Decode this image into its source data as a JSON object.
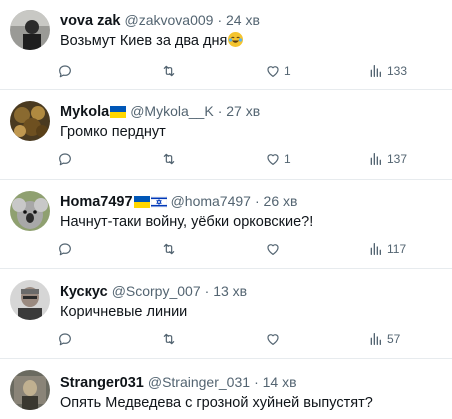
{
  "tweets": [
    {
      "name": "vova zak",
      "handle": "@zakvova009",
      "time": "· 24 хв",
      "text": "Возьмут Киев за два дня",
      "emoji": "face-with-tears-of-joy",
      "likes": "1",
      "views": "133",
      "flags": []
    },
    {
      "name": "Mykola",
      "handle": "@Mykola__K",
      "time": "· 27 хв",
      "text": "Громко перднут",
      "likes": "1",
      "views": "137",
      "flags": [
        "ukraine-flag"
      ]
    },
    {
      "name": "Homa7497",
      "handle": "@homa7497",
      "time": "· 26 хв",
      "text": "Начнут-таки войну, уёбки орковские?!",
      "likes": "",
      "views": "117",
      "flags": [
        "ukraine-flag",
        "israel-flag"
      ]
    },
    {
      "name": "Кускус",
      "handle": "@Scorpy_007",
      "time": "· 13 хв",
      "text": "Коричневые линии",
      "likes": "",
      "views": "57",
      "flags": []
    },
    {
      "name": "Stranger031",
      "handle": "@Strainger_031",
      "time": "· 14 хв",
      "text": "Опять Медведева с грозной хуйней выпустят?",
      "likes": "",
      "views": "",
      "flags": []
    }
  ],
  "colors": {
    "text": "#0f1419",
    "secondary": "#536471",
    "divider": "#e7ebee",
    "ukraine_blue": "#0057b7",
    "ukraine_yellow": "#ffd700",
    "israel_blue": "#0038b8"
  },
  "icons": [
    "reply-icon",
    "retweet-icon",
    "like-icon",
    "views-icon"
  ]
}
